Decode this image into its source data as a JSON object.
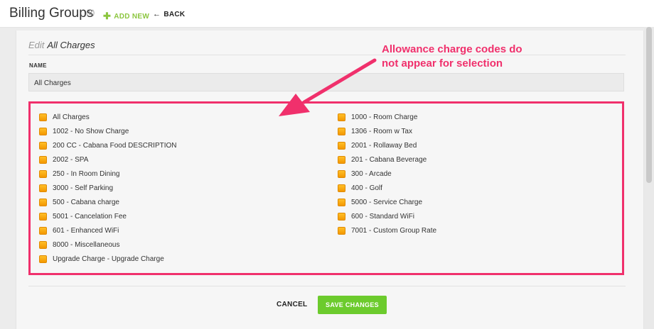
{
  "header": {
    "title": "Billing Groups",
    "count": "(8)",
    "add_new_label": "ADD NEW",
    "add_icon": "plus-icon",
    "back_label": "BACK",
    "back_icon": "arrow-left-icon",
    "accent_color": "#8cc63f"
  },
  "form": {
    "edit_prefix": "Edit",
    "edit_name": "All Charges",
    "name_label": "NAME",
    "name_value": "All Charges"
  },
  "charges": {
    "left": [
      "All Charges",
      "1002 - No Show Charge",
      "200 CC - Cabana Food DESCRIPTION",
      "2002 - SPA",
      "250 - In Room Dining",
      "3000 - Self Parking",
      "500 - Cabana charge",
      "5001 - Cancelation Fee",
      "601 - Enhanced WiFi",
      "8000 - Miscellaneous",
      "Upgrade Charge - Upgrade Charge"
    ],
    "right": [
      "1000 - Room Charge",
      "1306 - Room w Tax",
      "2001 - Rollaway Bed",
      "201 - Cabana Beverage",
      "300 - Arcade",
      "400 - Golf",
      "5000 - Service Charge",
      "600 - Standard WiFi",
      "7001 - Custom Group Rate"
    ],
    "checkbox_color": "#f7a21b"
  },
  "actions": {
    "cancel_label": "CANCEL",
    "save_label": "SAVE CHANGES",
    "save_color": "#6ccb2d"
  },
  "annotation": {
    "line1": "Allowance charge codes do",
    "line2": "not appear for selection",
    "color": "#f0306c"
  }
}
